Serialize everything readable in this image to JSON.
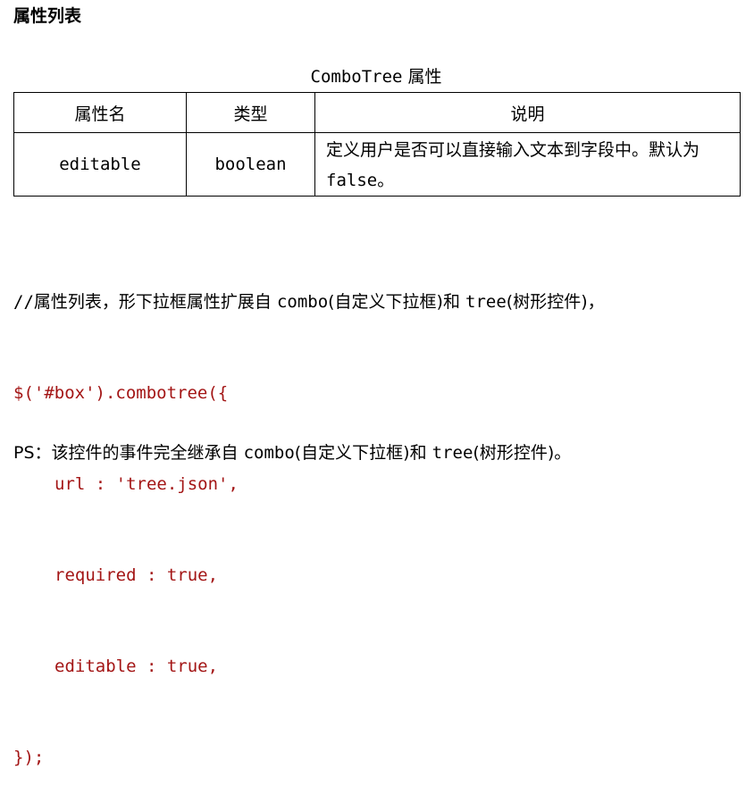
{
  "section_title": "属性列表",
  "table": {
    "caption_prefix": "ComboTree",
    "caption_suffix": " 属性",
    "headers": [
      "属性名",
      "类型",
      "说明"
    ],
    "rows": [
      {
        "name": "editable",
        "type": "boolean",
        "desc_before": "定义用户是否可以直接输入文本到字段中。默认为 ",
        "desc_code": "false",
        "desc_after": "。"
      }
    ]
  },
  "code": {
    "comment_a": "//",
    "comment_b": "属性列表，形下拉框属性扩展自 ",
    "comment_c": "combo",
    "comment_d": "(自定义下拉框)和 ",
    "comment_e": "tree",
    "comment_f": "(树形控件)，",
    "line2": "$('#box').combotree({",
    "line3": "url : 'tree.json',",
    "line4": "required : true,",
    "line5": "editable : true,",
    "line6": "});"
  },
  "ps": {
    "prefix": "PS：该控件的事件完全继承自 ",
    "combo": "combo",
    "mid": "(自定义下拉框)和 ",
    "tree": "tree",
    "suffix": "(树形控件)。"
  }
}
